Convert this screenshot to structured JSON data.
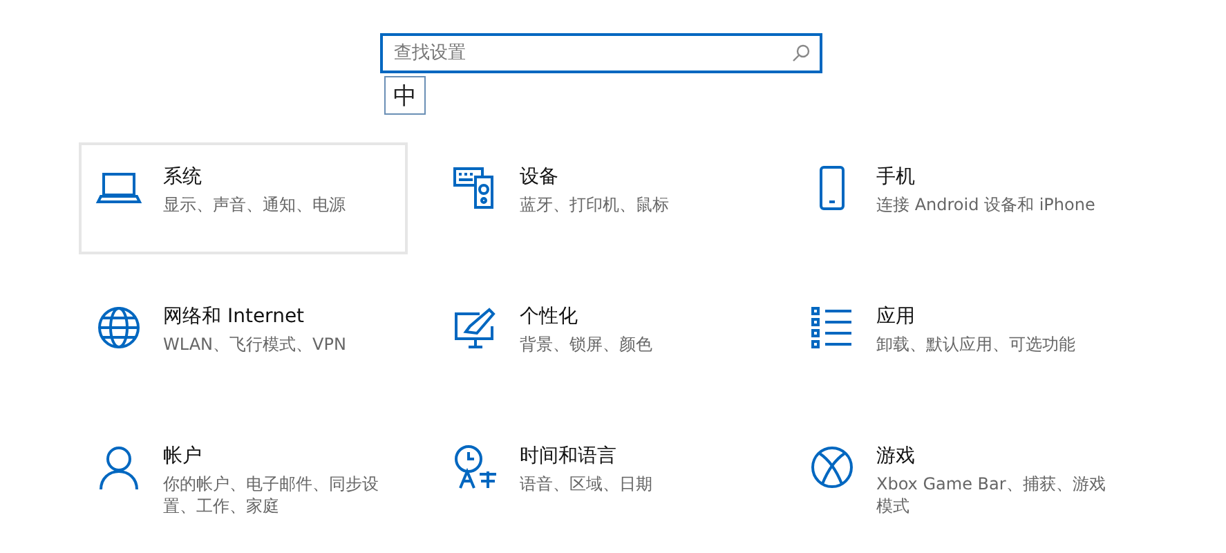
{
  "search": {
    "placeholder": "查找设置"
  },
  "ime_indicator": "中",
  "categories": [
    {
      "kind": "system",
      "title": "系统",
      "description": "显示、声音、通知、电源",
      "selected": true
    },
    {
      "kind": "devices",
      "title": "设备",
      "description": "蓝牙、打印机、鼠标",
      "selected": false
    },
    {
      "kind": "phone",
      "title": "手机",
      "description": "连接 Android 设备和 iPhone",
      "selected": false
    },
    {
      "kind": "network",
      "title": "网络和 Internet",
      "description": "WLAN、飞行模式、VPN",
      "selected": false
    },
    {
      "kind": "personalization",
      "title": "个性化",
      "description": "背景、锁屏、颜色",
      "selected": false
    },
    {
      "kind": "apps",
      "title": "应用",
      "description": "卸载、默认应用、可选功能",
      "selected": false
    },
    {
      "kind": "accounts",
      "title": "帐户",
      "description": "你的帐户、电子邮件、同步设置、工作、家庭",
      "selected": false
    },
    {
      "kind": "time",
      "title": "时间和语言",
      "description": "语音、区域、日期",
      "selected": false
    },
    {
      "kind": "gaming",
      "title": "游戏",
      "description": "Xbox Game Bar、捕获、游戏模式",
      "selected": false
    }
  ]
}
